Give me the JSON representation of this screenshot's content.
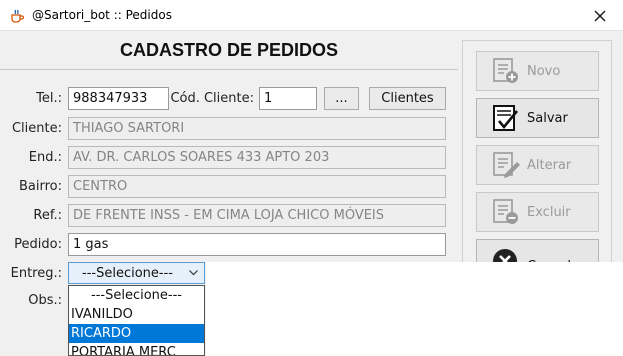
{
  "window": {
    "title": "@Sartori_bot :: Pedidos"
  },
  "form": {
    "heading": "CADASTRO DE PEDIDOS",
    "tel_label": "Tel.:",
    "tel_value": "988347933",
    "cod_cliente_label": "Cód. Cliente:",
    "cod_cliente_value": "1",
    "ellipsis_label": "...",
    "clientes_label": "Clientes",
    "cliente_label": "Cliente:",
    "cliente_value": "THIAGO SARTORI",
    "end_label": "End.:",
    "end_value": "AV. DR. CARLOS SOARES 433 APTO 203",
    "bairro_label": "Bairro:",
    "bairro_value": "CENTRO",
    "ref_label": "Ref.:",
    "ref_value": "DE FRENTE INSS - EM CIMA LOJA CHICO MÓVEIS",
    "pedido_label": "Pedido:",
    "pedido_value": "1 gas",
    "entreg_label": "Entreg.:",
    "entreg_selected": "---Selecione---",
    "obs_label": "Obs.:"
  },
  "dropdown": {
    "options": [
      "---Selecione---",
      "IVANILDO",
      "RICARDO",
      "PORTARIA MERC"
    ],
    "highlighted": "RICARDO"
  },
  "actions": {
    "novo": "Novo",
    "salvar": "Salvar",
    "alterar": "Alterar",
    "excluir": "Excluir",
    "cancelar": "Cancelar"
  },
  "colors": {
    "highlight": "#0078d7",
    "combo_border": "#5b9bd5"
  },
  "icons": {
    "app": "java-cup-icon",
    "close": "close-icon",
    "novo": "add-document-icon",
    "salvar": "checklist-icon",
    "alterar": "edit-document-icon",
    "excluir": "remove-document-icon",
    "cancelar": "cancel-circle-icon",
    "combo": "chevron-down-icon"
  }
}
